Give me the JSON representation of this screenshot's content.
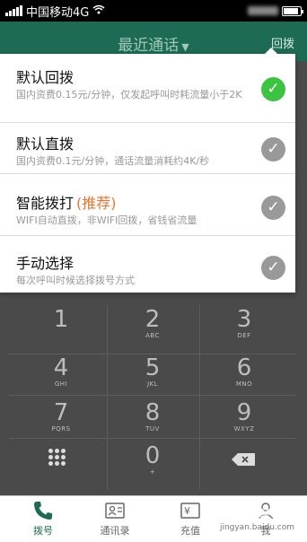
{
  "status": {
    "carrier": "中国移动4G"
  },
  "titlebar": {
    "title": "最近通话",
    "callback": "回拨"
  },
  "options": [
    {
      "label": "默认回拨",
      "recommend": "",
      "desc": "国内资费0.15元/分钟，仅发起呼叫时耗流量小于2K",
      "checked": true
    },
    {
      "label": "默认直拨",
      "recommend": "",
      "desc": "国内资费0.1元/分钟，通话流量消耗约4K/秒",
      "checked": false
    },
    {
      "label": "智能拨打",
      "recommend": "(推荐)",
      "desc": "WIFI自动直拨，非WIFI回拨，省钱省流量",
      "checked": false
    },
    {
      "label": "手动选择",
      "recommend": "",
      "desc": "每次呼叫时候选择拨号方式",
      "checked": false
    }
  ],
  "keypad": [
    {
      "digit": "1",
      "letters": ""
    },
    {
      "digit": "2",
      "letters": "ABC"
    },
    {
      "digit": "3",
      "letters": "DEF"
    },
    {
      "digit": "4",
      "letters": "GHI"
    },
    {
      "digit": "5",
      "letters": "JKL"
    },
    {
      "digit": "6",
      "letters": "MNO"
    },
    {
      "digit": "7",
      "letters": "PQRS"
    },
    {
      "digit": "8",
      "letters": "TUV"
    },
    {
      "digit": "9",
      "letters": "WXYZ"
    },
    {
      "digit": "0",
      "letters": "+"
    }
  ],
  "tabs": [
    {
      "label": "拨号",
      "icon": "phone-icon",
      "active": true
    },
    {
      "label": "通讯录",
      "icon": "contacts-icon",
      "active": false
    },
    {
      "label": "充值",
      "icon": "recharge-icon",
      "active": false
    },
    {
      "label": "我",
      "icon": "profile-icon",
      "active": false
    }
  ],
  "watermark": {
    "main": "Bai百度经验",
    "sub": "jingyan.baidu.com"
  },
  "colors": {
    "header": "#1d6b55",
    "checked": "#3cc441",
    "unchecked": "#999999",
    "recommend": "#e8752f"
  }
}
